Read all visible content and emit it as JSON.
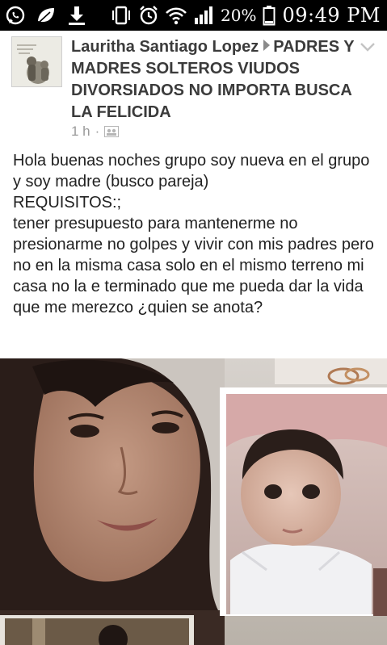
{
  "status_bar": {
    "battery_percent": "20%",
    "time": "09:49 PM",
    "icons": [
      "whatsapp-icon",
      "leaf-icon",
      "download-icon",
      "vibrate-icon",
      "alarm-icon",
      "wifi-icon",
      "signal-icon",
      "battery-icon"
    ],
    "battery_level": 0.2
  },
  "post": {
    "author": "Lauritha Santiago Lopez",
    "group": "PADRES Y MADRES SOLTEROS VIUDOS DIVORSIADOS NO IMPORTA BUSCA LA FELICIDA",
    "time_ago": "1 h",
    "separator": "·",
    "audience_icon": "group-icon",
    "text_lines": [
      "Hola buenas noches grupo soy nueva en el grupo y soy madre (busco pareja)",
      "REQUISITOS:;",
      "tener presupuesto para mantenerme no presionarme no golpes y vivir con mis padres pero no en la misma casa solo en el mismo terreno mi casa no la e terminado que me pueda dar la vida que me merezco ¿quien se anota?"
    ]
  },
  "colors": {
    "status_bar_bg": "#000000",
    "author_text": "#3b3b3b",
    "meta_text": "#9a9a9a",
    "body_text": "#222222"
  }
}
